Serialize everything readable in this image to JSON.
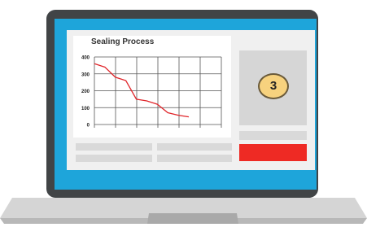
{
  "chart_data": {
    "type": "line",
    "title": "Sealing Process",
    "y_ticks": [
      "400",
      "300",
      "200",
      "100",
      "0"
    ],
    "ylim": [
      0,
      400
    ],
    "x": [
      0,
      1,
      2,
      3,
      4,
      5,
      6,
      7,
      8,
      9
    ],
    "values": [
      360,
      340,
      280,
      260,
      150,
      140,
      120,
      70,
      55,
      45
    ],
    "series_color": "#e0262b",
    "grid": true
  },
  "side_card": {
    "badge_value": "3"
  },
  "colors": {
    "screen": "#1ea5da",
    "lid": "#414446",
    "action": "#ee2a24",
    "badge": "#f7d27e"
  }
}
